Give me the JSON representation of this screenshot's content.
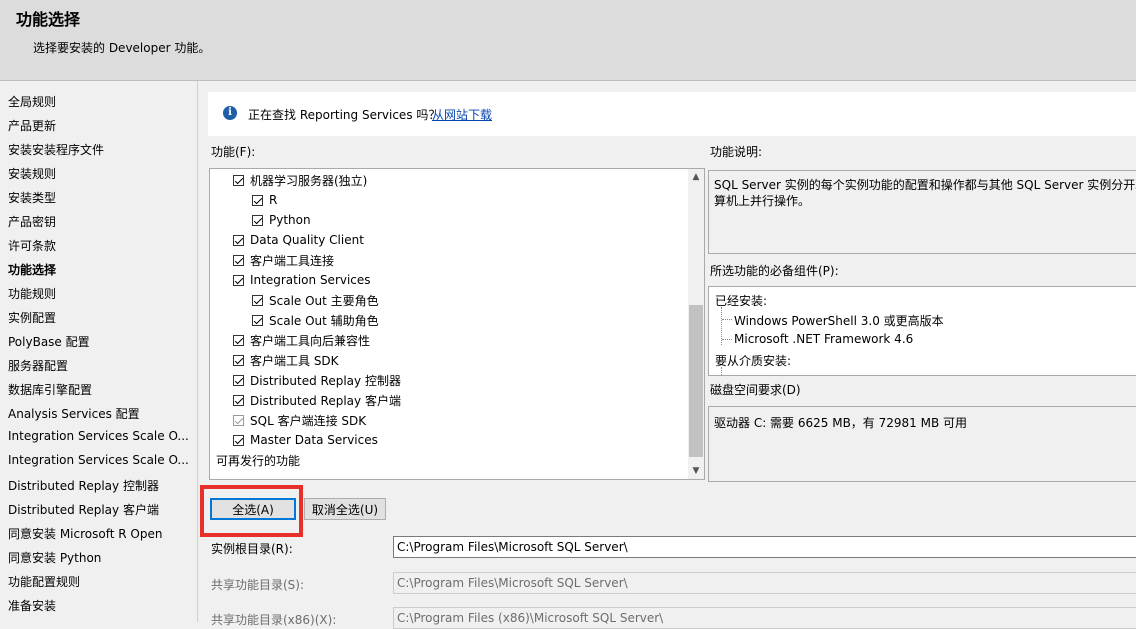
{
  "header": {
    "title": "功能选择",
    "subtitle": "选择要安装的 Developer 功能。"
  },
  "sidebar": {
    "items": [
      {
        "label": "全局规则"
      },
      {
        "label": "产品更新"
      },
      {
        "label": "安装安装程序文件"
      },
      {
        "label": "安装规则"
      },
      {
        "label": "安装类型"
      },
      {
        "label": "产品密钥"
      },
      {
        "label": "许可条款"
      },
      {
        "label": "功能选择",
        "active": true
      },
      {
        "label": "功能规则"
      },
      {
        "label": "实例配置"
      },
      {
        "label": "PolyBase 配置"
      },
      {
        "label": "服务器配置"
      },
      {
        "label": "数据库引擎配置"
      },
      {
        "label": "Analysis Services 配置"
      },
      {
        "label": "Integration Services Scale O..."
      },
      {
        "label": "Integration Services Scale O..."
      },
      {
        "label": "Distributed Replay 控制器"
      },
      {
        "label": "Distributed Replay 客户端"
      },
      {
        "label": "同意安装 Microsoft R Open"
      },
      {
        "label": "同意安装 Python"
      },
      {
        "label": "功能配置规则"
      },
      {
        "label": "准备安装"
      }
    ]
  },
  "notice": {
    "text": "正在查找 Reporting Services 吗？",
    "link": "从网站下载"
  },
  "features": {
    "label": "功能(F):",
    "items": [
      {
        "label": "机器学习服务器(独立)"
      },
      {
        "label": "R"
      },
      {
        "label": "Python"
      },
      {
        "label": "Data Quality Client"
      },
      {
        "label": "客户端工具连接"
      },
      {
        "label": "Integration Services"
      },
      {
        "label": "Scale Out 主要角色"
      },
      {
        "label": "Scale Out 辅助角色"
      },
      {
        "label": "客户端工具向后兼容性"
      },
      {
        "label": "客户端工具 SDK"
      },
      {
        "label": "Distributed Replay 控制器"
      },
      {
        "label": "Distributed Replay 客户端"
      },
      {
        "label": "SQL 客户端连接 SDK"
      },
      {
        "label": "Master Data Services"
      }
    ],
    "footer_group": "可再发行的功能"
  },
  "description": {
    "label": "功能说明:",
    "line1": "SQL Server 实例的每个实例功能的配置和操作都与其他 SQL Server 实例分开。",
    "line2": "算机上并行操作。"
  },
  "prerequisites": {
    "label": "所选功能的必备组件(P):",
    "installed_label": "已经安装:",
    "installed": [
      "Windows PowerShell 3.0 或更高版本",
      "Microsoft .NET Framework 4.6"
    ],
    "to_install_label": "要从介质安装:"
  },
  "disk": {
    "label": "磁盘空间要求(D)",
    "text": "驱动器 C: 需要 6625 MB，有 72981 MB 可用"
  },
  "buttons": {
    "select_all": "全选(A)",
    "unselect_all": "取消全选(U)"
  },
  "directories": {
    "instance_root_label": "实例根目录(R):",
    "instance_root_value": "C:\\Program Files\\Microsoft SQL Server\\",
    "shared_label": "共享功能目录(S):",
    "shared_value": "C:\\Program Files\\Microsoft SQL Server\\",
    "shared_x86_label": "共享功能目录(x86)(X):",
    "shared_x86_value": "C:\\Program Files (x86)\\Microsoft SQL Server\\"
  },
  "colors": {
    "highlight": "#e8302a",
    "link": "#0645ad",
    "info_icon": "#1f5fa8"
  }
}
